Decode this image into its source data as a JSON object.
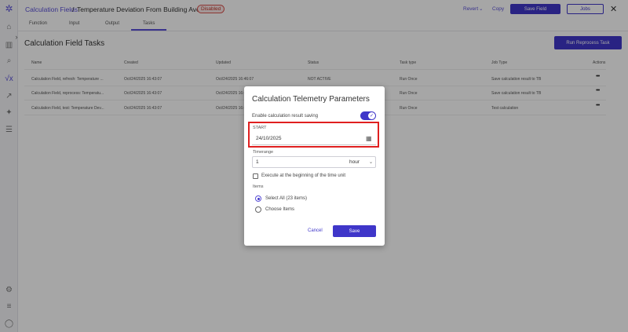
{
  "sidebar": {
    "icons": [
      "logo-icon",
      "home-icon",
      "chart-icon",
      "search-icon",
      "calc-icon",
      "trend-icon",
      "sparkle-icon",
      "menu-icon",
      "gear-icon",
      "list-icon",
      "user-icon"
    ]
  },
  "header": {
    "breadcrumb_link": "Calculation Fields",
    "breadcrumb_sep": "/",
    "title": "Temperature Deviation From Building Ave...",
    "status_badge": "Disabled",
    "revert_label": "Revert",
    "copy_label": "Copy",
    "save_field_label": "Save Field",
    "jobs_label": "Jobs"
  },
  "tabs": [
    "Function",
    "Input",
    "Output",
    "Tasks"
  ],
  "section_title": "Calculation Field Tasks",
  "run_reprocess_label": "Run Reprocess Task",
  "table": {
    "headers": [
      "Name",
      "Created",
      "Updated",
      "Status",
      "Task type",
      "Job Type",
      "Actions"
    ],
    "rows": [
      [
        "Calculation Field, refresh: Temperature ...",
        "Oct/24/2025 16:43:07",
        "Oct/24/2025 16:46:07",
        "NOT ACTIVE",
        "Run Once",
        "Save calculation result to TB"
      ],
      [
        "Calculation Field, reprocess: Temperatu...",
        "Oct/24/2025 16:43:07",
        "Oct/24/2025 16:43:07",
        "",
        "Run Once",
        "Save calculation result to TB"
      ],
      [
        "Calculation Field, test: Temperature Dev...",
        "Oct/24/2025 16:43:07",
        "Oct/24/2025 16:43:07",
        "",
        "Run Once",
        "Test calculation"
      ]
    ]
  },
  "dialog": {
    "title": "Calculation Telemetry Parameters",
    "enable_label": "Enable calculation result saving",
    "start_label": "START",
    "start_value": "24/10/2025",
    "timerange_label": "Timerange",
    "timerange_value": "1",
    "timerange_unit": "hour",
    "execute_label": "Execute at the beginning of the time unit",
    "items_label": "Items",
    "select_all_label": "Select All (23 items)",
    "choose_items_label": "Choose Items",
    "cancel_label": "Cancel",
    "save_label": "Save"
  },
  "colors": {
    "accent": "#3f36c9",
    "highlight": "#e02020",
    "badge": "#c0392b"
  }
}
